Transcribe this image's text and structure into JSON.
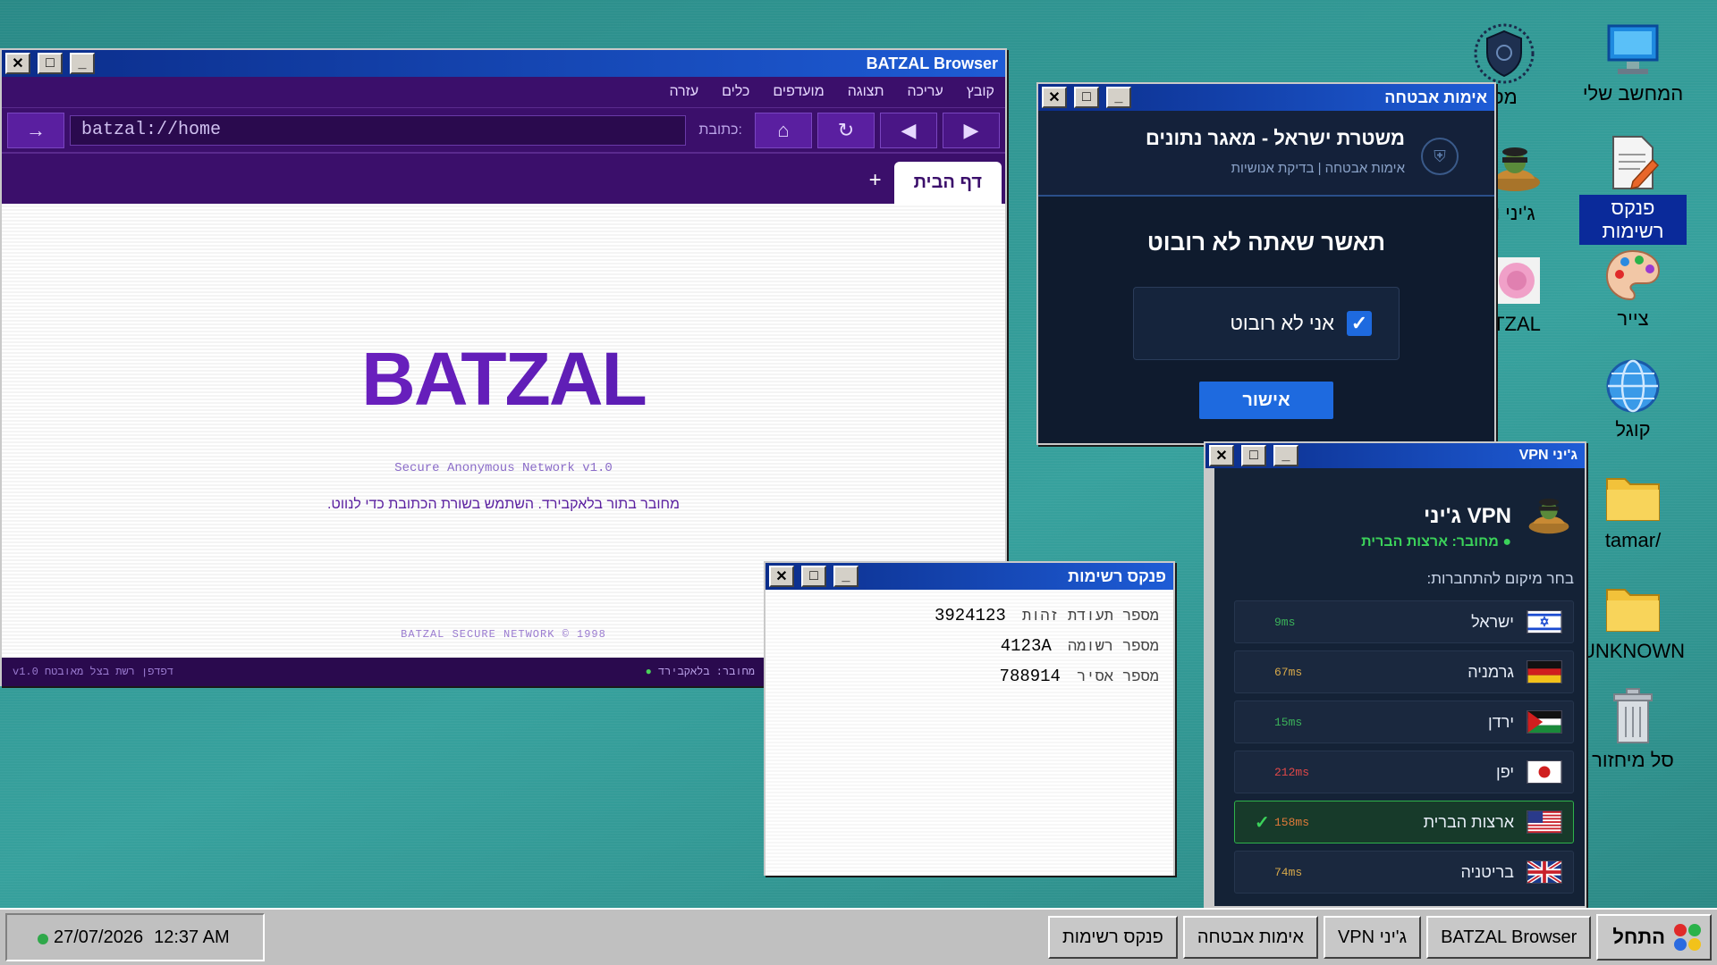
{
  "desktop": {
    "icons": [
      {
        "label": "המחשב שלי",
        "icon": "computer-icon"
      },
      {
        "label": "פנקס רשימות",
        "icon": "notepad-icon"
      },
      {
        "label": "צייר",
        "icon": "paint-palette-icon"
      },
      {
        "label": "קוגל",
        "icon": "globe-icon"
      },
      {
        "label": "/tamar",
        "icon": "folder-icon"
      },
      {
        "label": "UNKNOWN",
        "icon": "folder-icon"
      },
      {
        "label": "סל מיחזור",
        "icon": "recycle-bin-icon"
      },
      {
        "label": "מס",
        "icon": "police-badge-icon"
      },
      {
        "label": "ג'יני ו",
        "icon": "genie-icon"
      },
      {
        "label": "TZAL",
        "icon": "batzal-icon"
      }
    ]
  },
  "browser": {
    "title": "BATZAL Browser",
    "menu": [
      "קובץ",
      "עריכה",
      "תצוגה",
      "מועדפים",
      "כלים",
      "עזרה"
    ],
    "address_label": "כתובת:",
    "url": "batzal://home",
    "go_symbol": "→",
    "tab_label": "דף הבית",
    "tab_plus": "+",
    "logo": "BATZAL",
    "tagline": "Secure Anonymous Network v1.0",
    "hint": "מחובר בתור בלאקבירד. השתמש בשורת הכתובת כדי לנווט.",
    "copyright": "BATZAL SECURE NETWORK © 1998",
    "status_left": "v1.0 דפדפן רשת בצל מאובטח",
    "status_right": "מחובר: בלאקבירד",
    "status_dot": "●"
  },
  "security": {
    "title": "אימות אבטחה",
    "header_title": "משטרת ישראל - מאגר נתונים",
    "header_sub": "אימות אבטחה | בדיקת אנושיות",
    "question": "תאשר שאתה לא רובוט",
    "checkbox_label": "אני לא רובוט",
    "checked": true,
    "confirm_label": "אישור",
    "accent": "#1e6adf"
  },
  "vpn": {
    "title": "ג'יני VPN",
    "name": "ג'יני VPN",
    "status": "● מחובר: ארצות הברית",
    "choose_label": "בחר מיקום להתחברות:",
    "locations": [
      {
        "name": "ישראל",
        "ping": "9ms",
        "ping_color": "#3bb25a",
        "flag": "il"
      },
      {
        "name": "גרמניה",
        "ping": "67ms",
        "ping_color": "#d6a84a",
        "flag": "de"
      },
      {
        "name": "ירדן",
        "ping": "15ms",
        "ping_color": "#3bb25a",
        "flag": "jo"
      },
      {
        "name": "יפן",
        "ping": "212ms",
        "ping_color": "#e04848",
        "flag": "jp"
      },
      {
        "name": "ארצות הברית",
        "ping": "158ms",
        "ping_color": "#e07a3a",
        "flag": "us",
        "active": true,
        "check": "✓"
      },
      {
        "name": "בריטניה",
        "ping": "74ms",
        "ping_color": "#d6a84a",
        "flag": "gb"
      }
    ]
  },
  "notepad": {
    "title": "פנקס רשימות",
    "lines": [
      {
        "key": "מספר תעודת זהות",
        "value": "3924123"
      },
      {
        "key": "מספר רשומה",
        "value": "4123A"
      },
      {
        "key": "מספר אסיר",
        "value": "788914"
      }
    ]
  },
  "taskbar": {
    "start_label": "התחל",
    "items": [
      "BATZAL Browser",
      "ג'יני VPN",
      "אימות אבטחה",
      "פנקס רשימות"
    ],
    "date": "27/07/2026",
    "time": "12:37 AM"
  },
  "window_buttons": {
    "close": "✕",
    "maximize": "□",
    "minimize": "_"
  }
}
